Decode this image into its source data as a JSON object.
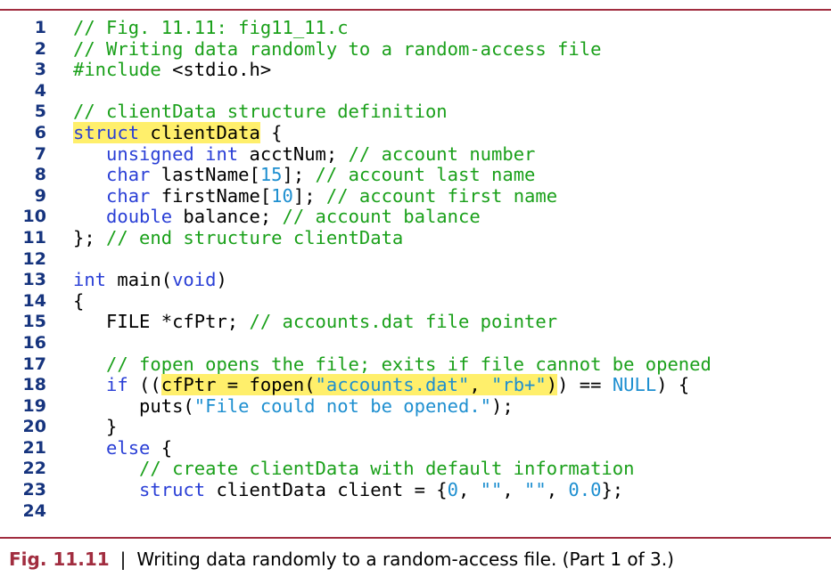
{
  "code_lines": [
    {
      "n": "1",
      "tokens": [
        {
          "t": "// Fig. 11.11: fig11_11.c",
          "k": "c"
        }
      ]
    },
    {
      "n": "2",
      "tokens": [
        {
          "t": "// Writing data randomly to a random-access file",
          "k": "c"
        }
      ]
    },
    {
      "n": "3",
      "tokens": [
        {
          "t": "#include ",
          "k": "c"
        },
        {
          "t": "<stdio.h>",
          "k": "p"
        }
      ]
    },
    {
      "n": "4",
      "tokens": []
    },
    {
      "n": "5",
      "tokens": [
        {
          "t": "// clientData structure definition",
          "k": "c"
        }
      ]
    },
    {
      "n": "6",
      "tokens": [
        {
          "t": "struct",
          "k": "k",
          "hl": true
        },
        {
          "t": " clientData",
          "k": "p",
          "hl": true
        },
        {
          "t": " {",
          "k": "p"
        }
      ]
    },
    {
      "n": "7",
      "tokens": [
        {
          "t": "   unsigned int",
          "k": "k"
        },
        {
          "t": " acctNum; ",
          "k": "p"
        },
        {
          "t": "// account number",
          "k": "c"
        }
      ]
    },
    {
      "n": "8",
      "tokens": [
        {
          "t": "   char",
          "k": "k"
        },
        {
          "t": " lastName[",
          "k": "p"
        },
        {
          "t": "15",
          "k": "n"
        },
        {
          "t": "]; ",
          "k": "p"
        },
        {
          "t": "// account last name",
          "k": "c"
        }
      ]
    },
    {
      "n": "9",
      "tokens": [
        {
          "t": "   char",
          "k": "k"
        },
        {
          "t": " firstName[",
          "k": "p"
        },
        {
          "t": "10",
          "k": "n"
        },
        {
          "t": "]; ",
          "k": "p"
        },
        {
          "t": "// account first name",
          "k": "c"
        }
      ]
    },
    {
      "n": "10",
      "tokens": [
        {
          "t": "   double",
          "k": "k"
        },
        {
          "t": " balance; ",
          "k": "p"
        },
        {
          "t": "// account balance",
          "k": "c"
        }
      ]
    },
    {
      "n": "11",
      "tokens": [
        {
          "t": "}; ",
          "k": "p"
        },
        {
          "t": "// end structure clientData",
          "k": "c"
        }
      ]
    },
    {
      "n": "12",
      "tokens": []
    },
    {
      "n": "13",
      "tokens": [
        {
          "t": "int",
          "k": "k"
        },
        {
          "t": " main(",
          "k": "p"
        },
        {
          "t": "void",
          "k": "k"
        },
        {
          "t": ")",
          "k": "p"
        }
      ]
    },
    {
      "n": "14",
      "tokens": [
        {
          "t": "{",
          "k": "p"
        }
      ]
    },
    {
      "n": "15",
      "tokens": [
        {
          "t": "   FILE *cfPtr; ",
          "k": "p"
        },
        {
          "t": "// accounts.dat file pointer",
          "k": "c"
        }
      ]
    },
    {
      "n": "16",
      "tokens": []
    },
    {
      "n": "17",
      "tokens": [
        {
          "t": "   // fopen opens the file; exits if file cannot be opened",
          "k": "c"
        }
      ]
    },
    {
      "n": "18",
      "tokens": [
        {
          "t": "   if",
          "k": "k"
        },
        {
          "t": " ((",
          "k": "p"
        },
        {
          "t": "cfPtr = fopen(",
          "k": "p",
          "hl": true
        },
        {
          "t": "\"accounts.dat\"",
          "k": "s",
          "hl": true
        },
        {
          "t": ", ",
          "k": "p",
          "hl": true
        },
        {
          "t": "\"rb+\"",
          "k": "s",
          "hl": true
        },
        {
          "t": ")",
          "k": "p",
          "hl": true
        },
        {
          "t": ") == ",
          "k": "p"
        },
        {
          "t": "NULL",
          "k": "n"
        },
        {
          "t": ") {",
          "k": "p"
        }
      ]
    },
    {
      "n": "19",
      "tokens": [
        {
          "t": "      puts(",
          "k": "p"
        },
        {
          "t": "\"File could not be opened.\"",
          "k": "s"
        },
        {
          "t": ");",
          "k": "p"
        }
      ]
    },
    {
      "n": "20",
      "tokens": [
        {
          "t": "   }",
          "k": "p"
        }
      ]
    },
    {
      "n": "21",
      "tokens": [
        {
          "t": "   else",
          "k": "k"
        },
        {
          "t": " {",
          "k": "p"
        }
      ]
    },
    {
      "n": "22",
      "tokens": [
        {
          "t": "      // create clientData with default information",
          "k": "c"
        }
      ]
    },
    {
      "n": "23",
      "tokens": [
        {
          "t": "      struct",
          "k": "k"
        },
        {
          "t": " clientData client = {",
          "k": "p"
        },
        {
          "t": "0",
          "k": "n"
        },
        {
          "t": ", ",
          "k": "p"
        },
        {
          "t": "\"\"",
          "k": "s"
        },
        {
          "t": ", ",
          "k": "p"
        },
        {
          "t": "\"\"",
          "k": "s"
        },
        {
          "t": ", ",
          "k": "p"
        },
        {
          "t": "0.0",
          "k": "n"
        },
        {
          "t": "};",
          "k": "p"
        }
      ]
    },
    {
      "n": "24",
      "tokens": []
    }
  ],
  "caption": {
    "label": "Fig. 11.11",
    "separator": "|",
    "text": "Writing data randomly to a random-access file. (Part 1 of 3.)"
  },
  "colors": {
    "rule": "#a12d3f",
    "keyword": "#2a3fd6",
    "comment": "#1aa01a",
    "string": "#1e8fd0",
    "highlight": "#ffef6b",
    "line_number": "#16347e"
  }
}
